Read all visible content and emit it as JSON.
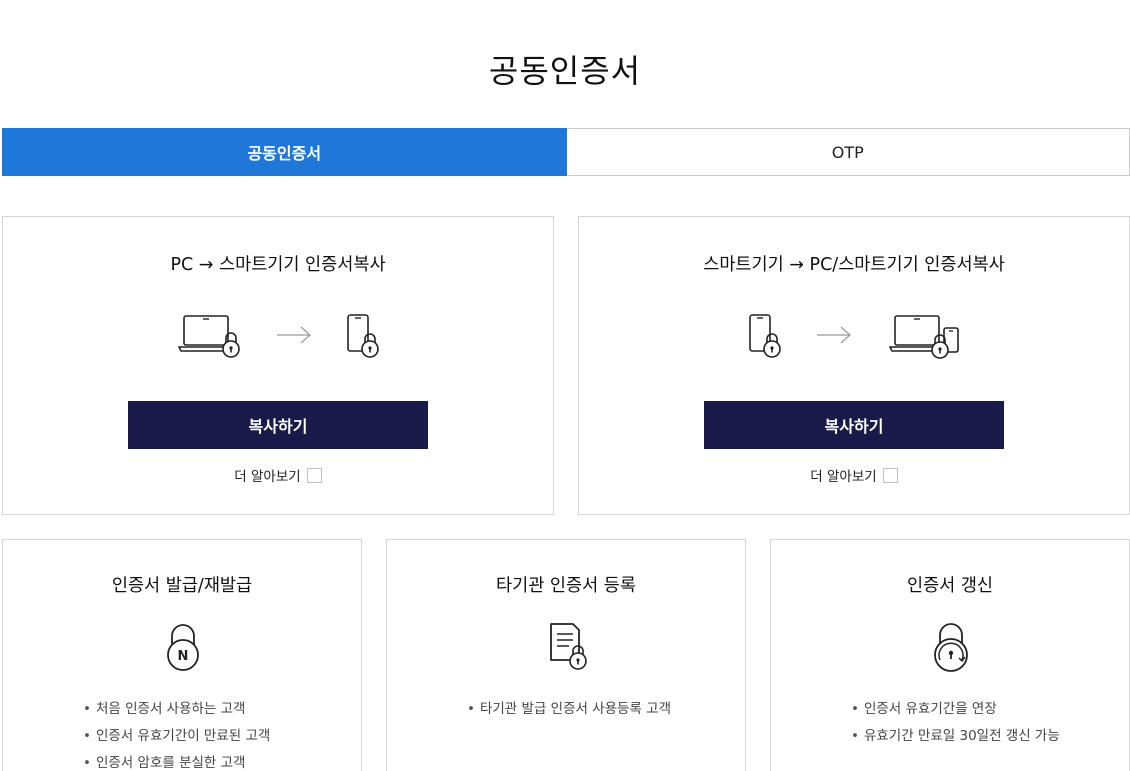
{
  "page": {
    "title": "공동인증서"
  },
  "tabs": [
    {
      "label": "공동인증서",
      "active": true
    },
    {
      "label": "OTP",
      "active": false
    }
  ],
  "colors": {
    "tab_active_bg": "#1f78d9",
    "button_bg": "#1a1a4a",
    "border": "#d6d6d6"
  },
  "copy_cards": [
    {
      "title": "PC → 스마트기기 인증서복사",
      "button_label": "복사하기",
      "learn_more_label": "더 알아보기",
      "icons": [
        "laptop-lock-icon",
        "arrow-right-icon",
        "phone-lock-icon"
      ]
    },
    {
      "title": "스마트기기 → PC/스마트기기 인증서복사",
      "button_label": "복사하기",
      "learn_more_label": "더 알아보기",
      "icons": [
        "phone-lock-icon",
        "arrow-right-icon",
        "laptop-phone-lock-icon"
      ]
    }
  ],
  "service_cards": [
    {
      "title": "인증서 발급/재발급",
      "icon": "padlock-new-icon",
      "bullets": [
        "처음 인증서 사용하는 고객",
        "인증서 유효기간이 만료된 고객",
        "인증서 암호를 분실한 고객"
      ]
    },
    {
      "title": "타기관 인증서 등록",
      "icon": "document-lock-icon",
      "bullets": [
        "타기관 발급 인증서 사용등록 고객"
      ]
    },
    {
      "title": "인증서 갱신",
      "icon": "padlock-renew-icon",
      "bullets": [
        "인증서 유효기간을 연장",
        "유효기간 만료일 30일전 갱신 가능"
      ]
    }
  ]
}
